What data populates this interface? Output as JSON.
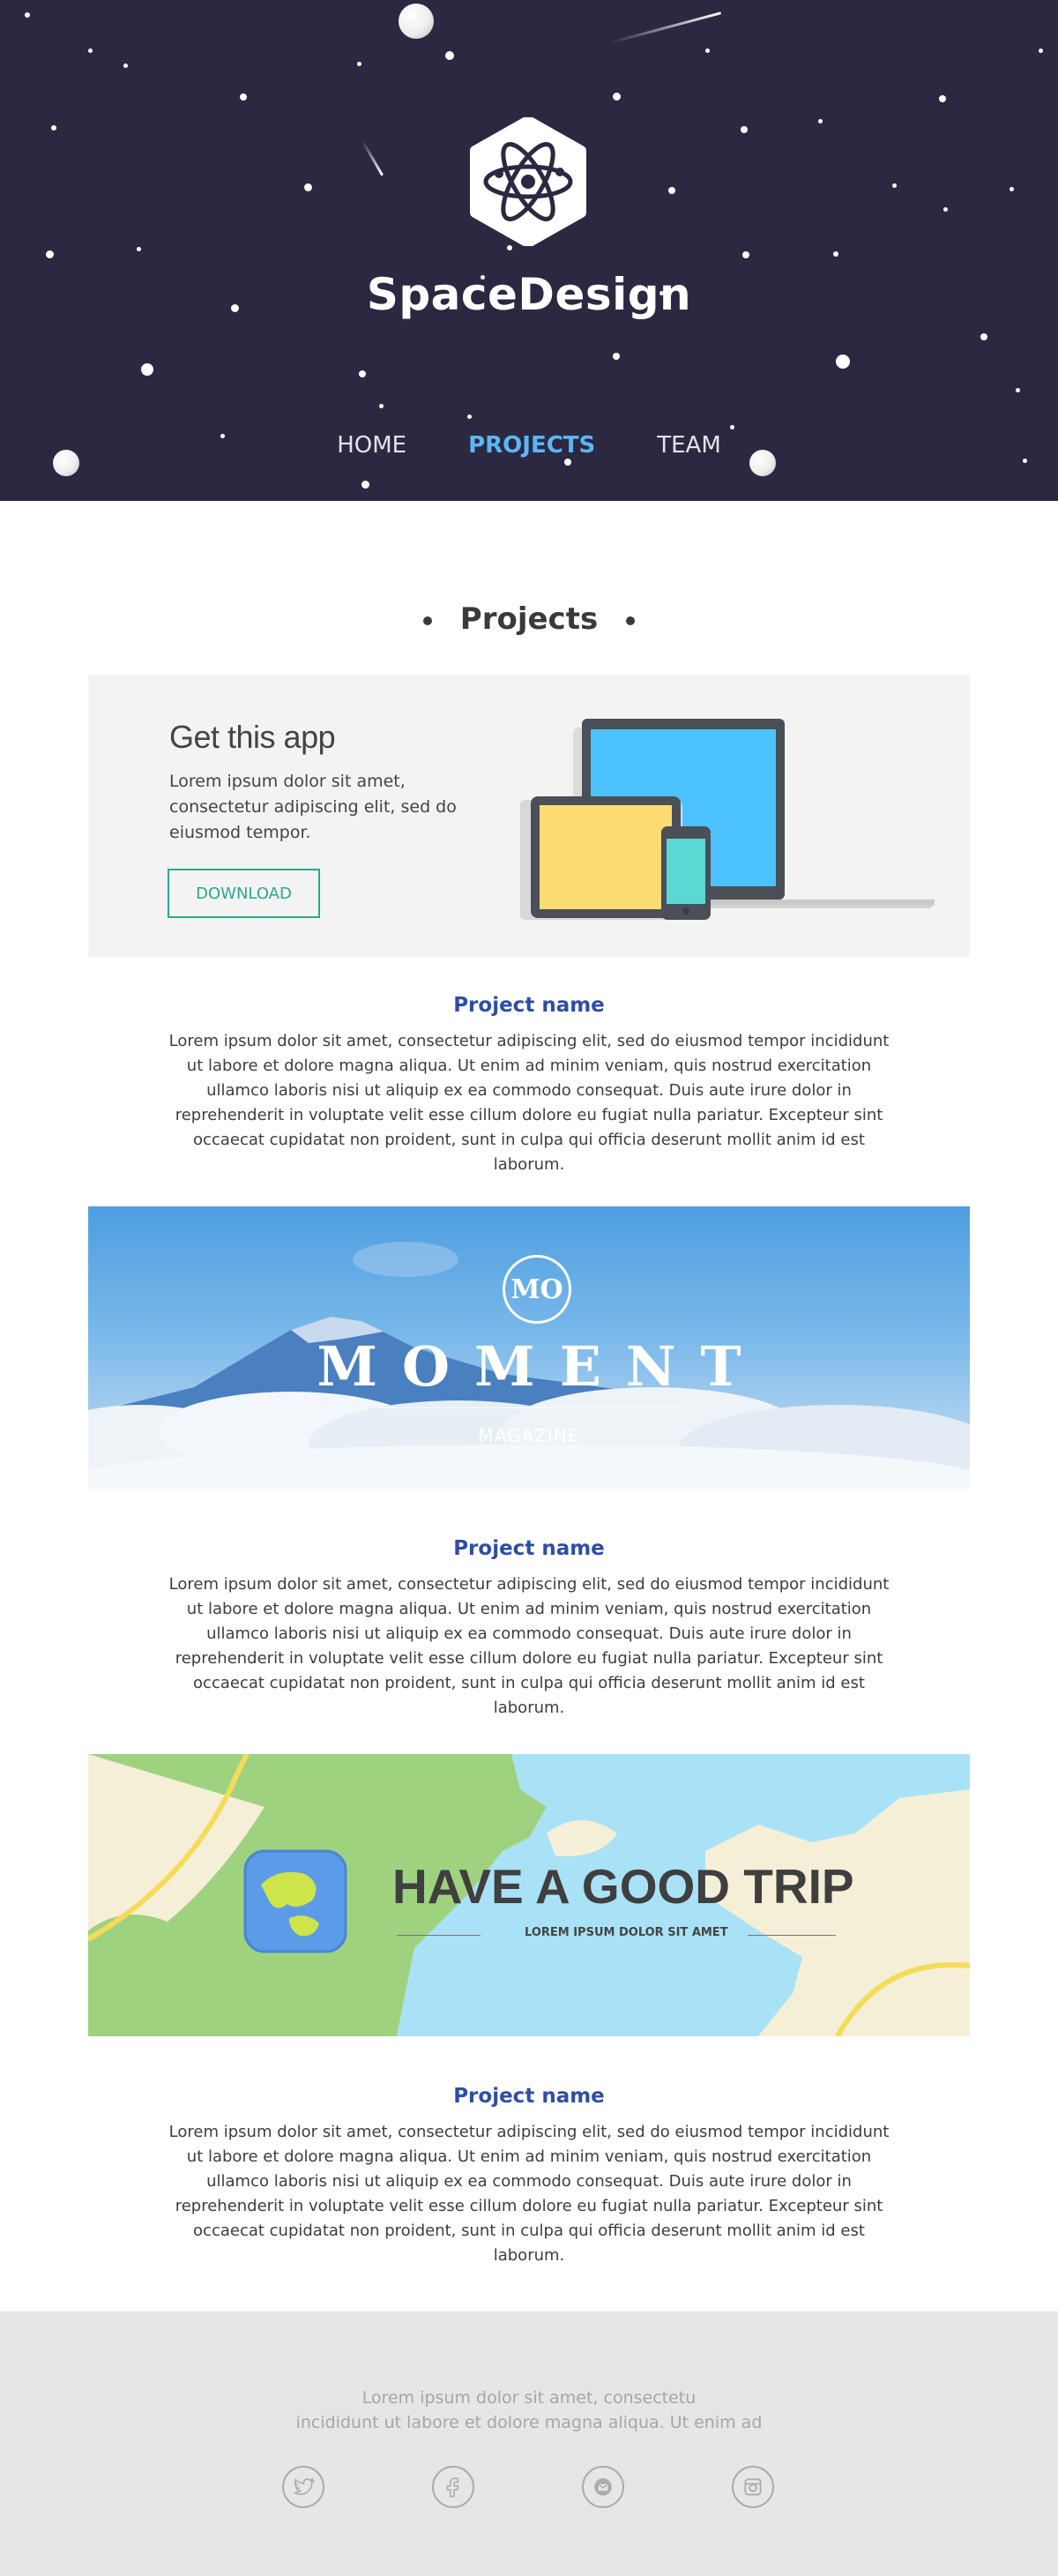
{
  "brand": {
    "name": "SpaceDesign"
  },
  "nav": {
    "items": [
      {
        "label": "HOME"
      },
      {
        "label": "PROJECTS"
      },
      {
        "label": "TEAM"
      }
    ],
    "active": "PROJECTS"
  },
  "section": {
    "title": "Projects"
  },
  "app_promo": {
    "title": "Get this app",
    "description": "Lorem ipsum dolor sit amet, consectetur adipiscing elit, sed do eiusmod tempor.",
    "button_label": "DOWNLOAD"
  },
  "projects": [
    {
      "name": "Project name",
      "description": "Lorem ipsum dolor sit amet, consectetur adipiscing elit, sed do eiusmod tempor incididunt ut labore et dolore magna aliqua. Ut enim ad minim veniam, quis nostrud exercitation ullamco laboris nisi ut aliquip ex ea commodo consequat. Duis aute irure dolor in reprehenderit in voluptate velit esse cillum dolore eu fugiat nulla pariatur. Excepteur sint occaecat cupidatat non proident, sunt in culpa qui officia deserunt mollit anim id est laborum."
    },
    {
      "name": "Project name",
      "description": "Lorem ipsum dolor sit amet, consectetur adipiscing elit, sed do eiusmod tempor incididunt ut labore et dolore magna aliqua. Ut enim ad minim veniam, quis nostrud exercitation ullamco laboris nisi ut aliquip ex ea commodo consequat. Duis aute irure dolor in reprehenderit in voluptate velit esse cillum dolore eu fugiat nulla pariatur. Excepteur sint occaecat cupidatat non proident, sunt in culpa qui officia deserunt mollit anim id est laborum."
    },
    {
      "name": "Project name",
      "description": "Lorem ipsum dolor sit amet, consectetur adipiscing elit, sed do eiusmod tempor incididunt ut labore et dolore magna aliqua. Ut enim ad minim veniam, quis nostrud exercitation ullamco laboris nisi ut aliquip ex ea commodo consequat. Duis aute irure dolor in reprehenderit in voluptate velit esse cillum dolore eu fugiat nulla pariatur. Excepteur sint occaecat cupidatat non proident, sunt in culpa qui officia deserunt mollit anim id est laborum."
    }
  ],
  "moment_banner": {
    "logo": "MO",
    "title": "MOMENT",
    "subtitle": "MAGAZINE"
  },
  "trip_banner": {
    "title": "HAVE A GOOD TRIP",
    "subtitle": "LOREM IPSUM DOLOR SIT AMET"
  },
  "footer": {
    "line1": "Lorem ipsum dolor sit amet, consectetu",
    "line2": "incididunt ut labore et dolore magna aliqua. Ut enim ad",
    "social": [
      "twitter-icon",
      "facebook-icon",
      "mail-icon",
      "instagram-icon"
    ]
  },
  "colors": {
    "header_bg": "#2c2841",
    "nav_active": "#5bb6f4",
    "project_name": "#2e4da6",
    "download": "#2aa88f",
    "footer_bg": "#e6e6e6"
  }
}
